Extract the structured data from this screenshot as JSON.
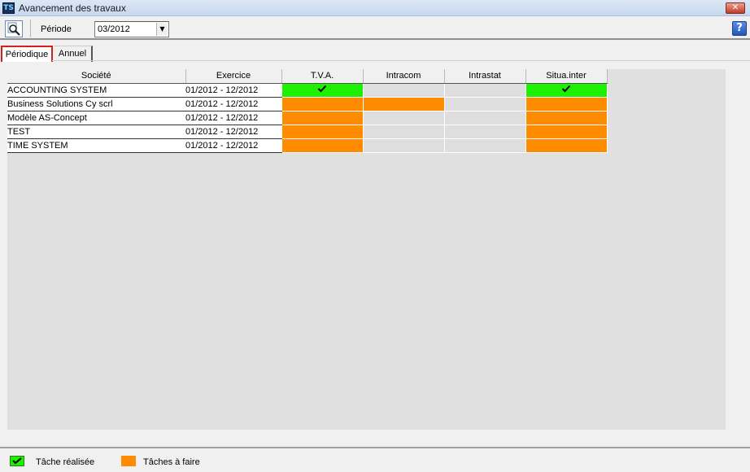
{
  "window": {
    "title": "Avancement des travaux",
    "app_icon": "TS",
    "close_glyph": "✕"
  },
  "toolbar": {
    "periode_label": "Période",
    "periode_value": "03/2012",
    "help_glyph": "?"
  },
  "tabs": [
    {
      "label": "Périodique",
      "active": true
    },
    {
      "label": "Annuel",
      "active": false
    }
  ],
  "grid": {
    "headers": [
      "Société",
      "Exercice",
      "T.V.A.",
      "Intracom",
      "Intrastat",
      "Situa.inter"
    ],
    "rows": [
      {
        "societe": "ACCOUNTING SYSTEM",
        "exercice": "01/2012 - 12/2012",
        "status": [
          "done",
          "none",
          "none",
          "done"
        ]
      },
      {
        "societe": "Business Solutions Cy scrl",
        "exercice": "01/2012 - 12/2012",
        "status": [
          "todo",
          "todo",
          "none",
          "todo"
        ]
      },
      {
        "societe": "Modèle AS-Concept",
        "exercice": "01/2012 - 12/2012",
        "status": [
          "todo",
          "none",
          "none",
          "todo"
        ]
      },
      {
        "societe": "TEST",
        "exercice": "01/2012 - 12/2012",
        "status": [
          "todo",
          "none",
          "none",
          "todo"
        ]
      },
      {
        "societe": "TIME SYSTEM",
        "exercice": "01/2012 - 12/2012",
        "status": [
          "todo",
          "none",
          "none",
          "todo"
        ]
      }
    ]
  },
  "legend": {
    "done_label": "Tâche réalisée",
    "todo_label": "Tâches à faire"
  },
  "colors": {
    "done": "#1df000",
    "todo": "#ff8c00",
    "none": "#dedede",
    "tab_highlight": "#d41f1f"
  },
  "icons": {
    "search": "search-icon",
    "check": "check-icon",
    "help": "help-icon",
    "close": "close-icon"
  }
}
